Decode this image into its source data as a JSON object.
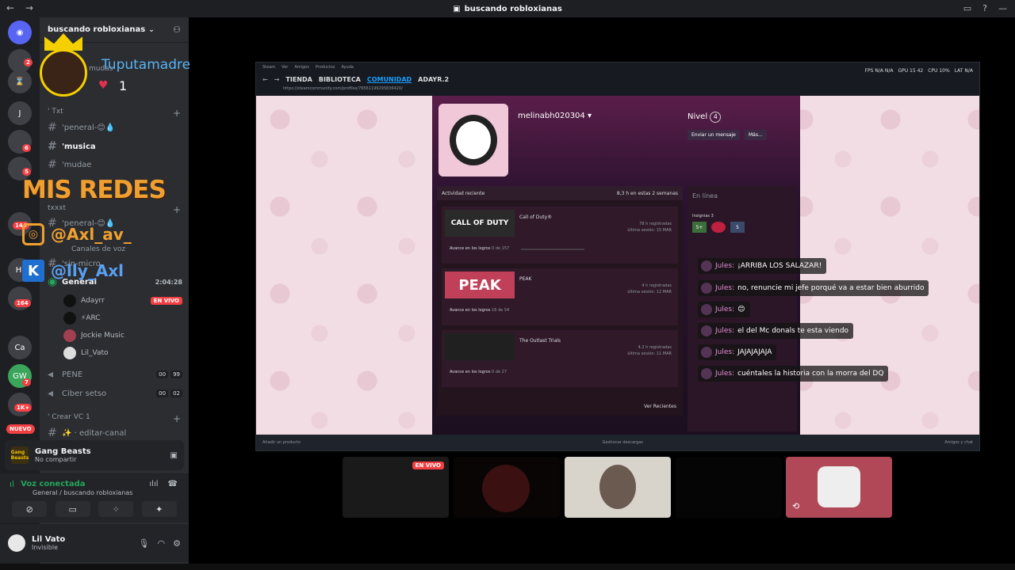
{
  "window": {
    "title": "buscando robloxianas",
    "back": "←",
    "forward": "→"
  },
  "guilds": {
    "badges": [
      "2",
      "6",
      "5",
      "144",
      "164",
      "7",
      "1K+"
    ],
    "letters": [
      "J",
      "HI",
      "Ca"
    ],
    "nuevo": "NUEVO"
  },
  "server": {
    "name": "buscando robloxianas",
    "categories": {
      "txt": "' Txt",
      "txxxt": "txxxt",
      "voz": "Canales de voz",
      "crear": "' Crear VC 1"
    },
    "channels": {
      "general1": "'peneral-😊💧",
      "musica": "'musica",
      "mudae": "'mudae",
      "general2": "'peneral-😊💧",
      "sinmicro": "'sin-micro",
      "general_voice": "General",
      "general_time": "2:04:28",
      "pene": "PENE",
      "pene_count": [
        "00",
        "99"
      ],
      "ciber": "Ciber setso",
      "ciber_count": [
        "00",
        "02"
      ],
      "editar": "✨ · editar-canal"
    },
    "voice_users": [
      {
        "name": "Adayrr",
        "live": "EN VIVO"
      },
      {
        "name": "⚡ARC"
      },
      {
        "name": "Jockie Music"
      },
      {
        "name": "Lil_Vato"
      }
    ]
  },
  "activity": {
    "game": "Gang Beasts",
    "status": "No compartir",
    "logo": "Gang Beasts"
  },
  "voice": {
    "state": "Voz conectada",
    "channel": "General / buscando robloxianas"
  },
  "user": {
    "name": "Lil Vato",
    "status": "Invisible"
  },
  "overlay": {
    "cam_name": "Tuputamadre",
    "cam_behind": "mudas",
    "heart_count": "1",
    "mis_redes": "MIS REDES",
    "instagram": "@Axl_av_",
    "kick": "@lly_Axl"
  },
  "steam": {
    "menu": [
      "Steam",
      "Ver",
      "Amigos",
      "Productos",
      "Ayuda"
    ],
    "nav": [
      "TIENDA",
      "BIBLIOTECA",
      "COMUNIDAD",
      "ADAYR.2"
    ],
    "address": "https://steamcommunity.com/profiles/76561199295836420/",
    "perf": [
      "FPS N/A N/A",
      "GPU 15 42",
      "CPU 10%",
      "LAT N/A"
    ],
    "profile_name": "melinabh020304",
    "level_label": "Nivel",
    "level": "4",
    "btn_message": "Enviar un mensaje",
    "btn_more": "Más...",
    "recent_label": "Actividad reciente",
    "recent_hours": "8,3 h en estas 2 semanas",
    "games": [
      {
        "name": "Call of Duty®",
        "thumb": "CALL OF DUTY",
        "hours": "78 h registradas",
        "last": "última sesión: 15 MAR",
        "ach": "Avance en los logros",
        "ach_val": "0 de 157"
      },
      {
        "name": "PEAK",
        "thumb": "PEAK",
        "hours": "4 h registradas",
        "last": "última sesión: 12 MAR",
        "ach": "Avance en los logros",
        "ach_val": "16 de 54"
      },
      {
        "name": "The Outlast Trials",
        "thumb": "",
        "hours": "4,2 h registradas",
        "last": "última sesión: 11 MAR",
        "ach": "Avance en los logros",
        "ach_val": "0 de 27"
      }
    ],
    "ver_mas": "Ver Recientes",
    "online": "En línea",
    "insignias": "Insignias",
    "insignias_count": "3",
    "badge_vals": [
      "5+",
      "",
      "5"
    ],
    "bottom_left": "Añadir un producto",
    "bottom_mid": "Gestionar descargas",
    "bottom_right": "Amigos y chat"
  },
  "chat": [
    {
      "name": "Jules:",
      "text": "¡ARRIBA LOS SALAZAR!"
    },
    {
      "name": "Jules:",
      "text": "no, renuncie mi jefe porqué va a estar bien aburrido"
    },
    {
      "name": "Jules:",
      "text": "😊"
    },
    {
      "name": "Jules:",
      "text": "el del Mc donals te esta viendo"
    },
    {
      "name": "Jules:",
      "text": "JAJAJAJAJA"
    },
    {
      "name": "Jules:",
      "text": "cuéntales la historia con la morra del DQ"
    }
  ],
  "tiles": {
    "live": "EN VIVO"
  }
}
